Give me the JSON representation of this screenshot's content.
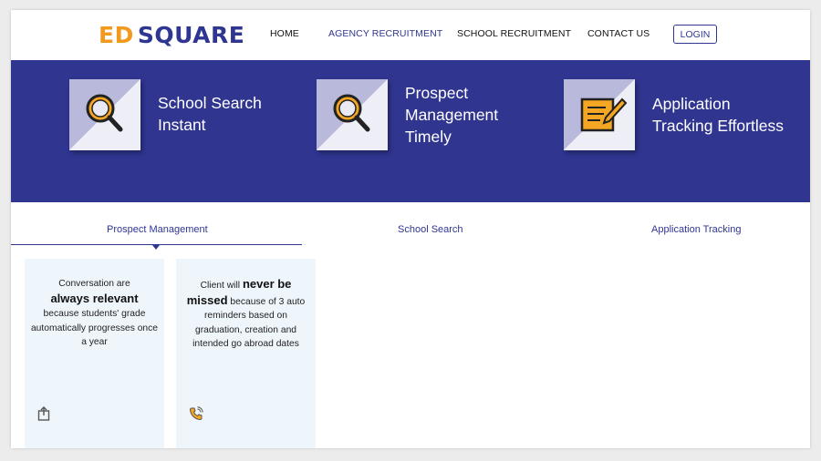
{
  "brand": {
    "logo_prefix": "ED",
    "logo_word": "SQUARE"
  },
  "nav": {
    "items": [
      "HOME",
      "AGENCY RECRUITMENT",
      "SCHOOL RECRUITMENT",
      "CONTACT US"
    ],
    "active": "AGENCY RECRUITMENT",
    "login_label": "LOGIN"
  },
  "features": [
    {
      "icon": "magnifier-icon",
      "lines": [
        "School Search",
        "Instant"
      ]
    },
    {
      "icon": "magnifier-icon",
      "lines": [
        "Prospect",
        "Management",
        "Timely"
      ]
    },
    {
      "icon": "notepad-pencil-icon",
      "lines": [
        "Application",
        "Tracking Effortless"
      ]
    }
  ],
  "tabs": {
    "items": [
      "Prospect Management",
      "School Search",
      "Application Tracking"
    ],
    "active": "Prospect Management"
  },
  "cards": [
    {
      "before": "Conversation are",
      "bold": "always relevant",
      "after": "because students' grade automatically progresses once a year",
      "icon": "upload-box-icon"
    },
    {
      "before": "Client will",
      "bold": "never be missed",
      "after": "because of 3 auto reminders based on graduation, creation and intended go abroad dates",
      "icon": "phone-ring-icon"
    }
  ],
  "colors": {
    "brand_navy": "#303590",
    "brand_orange": "#f29a1e",
    "card_bg": "#eef6fc"
  }
}
